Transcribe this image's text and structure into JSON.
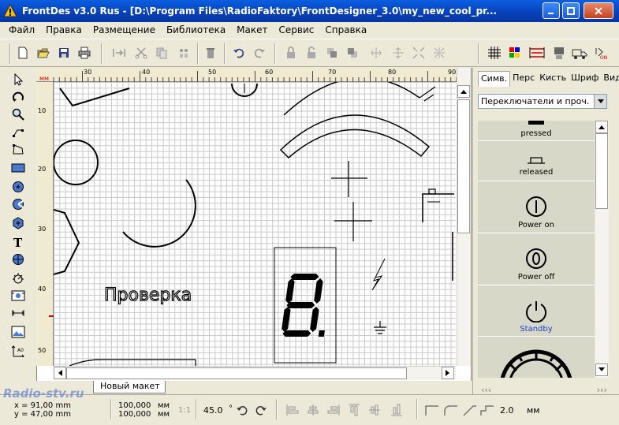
{
  "window": {
    "title": "FrontDes v3.0 Rus - [D:\\Program Files\\RadioFaktory\\FrontDesigner_3.0\\my_new_cool_pr...",
    "controls": [
      "minimize",
      "restore",
      "close"
    ]
  },
  "menu": [
    "Файл",
    "Правка",
    "Размещение",
    "Библиотека",
    "Макет",
    "Сервис",
    "Справка"
  ],
  "ruler": {
    "unit": "мм",
    "top_ticks": [
      "30",
      "40",
      "50",
      "60",
      "70",
      "80",
      "90"
    ],
    "left_ticks": [
      "10",
      "20",
      "30",
      "40",
      "50"
    ]
  },
  "canvas": {
    "text_object": "Проверка",
    "seven_segment": "8."
  },
  "tabs": [
    "Новый макет"
  ],
  "right_panel": {
    "tabs": [
      "Симв.",
      "Перс",
      "Кисть",
      "Шриф",
      "Вид"
    ],
    "active_tab": "Симв.",
    "category": "Переключатели и проч.",
    "symbols": [
      {
        "label": "pressed",
        "color": "#000000"
      },
      {
        "label": "released",
        "color": "#000000"
      },
      {
        "label": "Power on",
        "color": "#000000"
      },
      {
        "label": "Power off",
        "color": "#000000"
      },
      {
        "label": "Standby",
        "color": "#1a3fd0"
      }
    ],
    "nav_left": "‹‹‹",
    "nav_right": "›››"
  },
  "status": {
    "x": "x = 91,00 mm",
    "y": "y = 47,00 mm",
    "w": "100,000",
    "h": "100,000",
    "unit1": "мм",
    "unit2": "мм",
    "scale": "1:1",
    "angle": "45.0",
    "degree": "°",
    "line_width": "2.0",
    "unit3": "мм"
  },
  "watermark": "Radio-stv.ru",
  "colors": {
    "title_bar": "#0840b8",
    "accent": "#1a3fd0",
    "warning_yellow": "#f5c400"
  }
}
